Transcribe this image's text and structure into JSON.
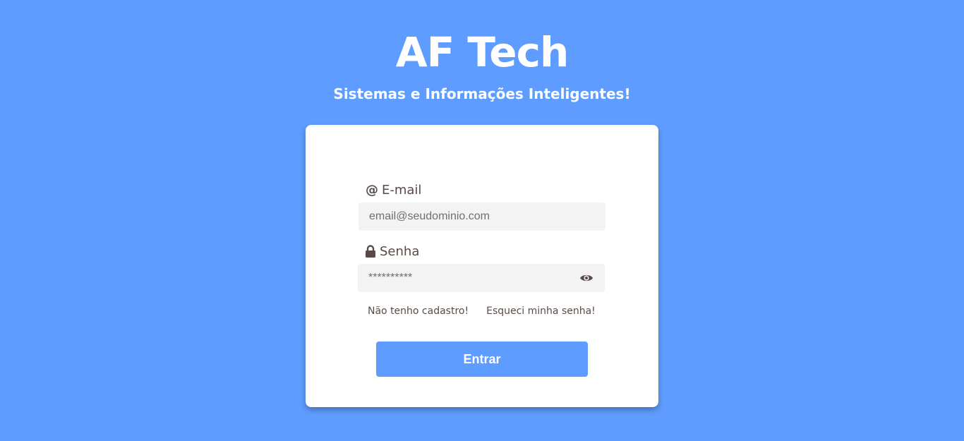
{
  "header": {
    "title": "AF Tech",
    "subtitle": "Sistemas e Informações Inteligentes!"
  },
  "form": {
    "email": {
      "icon": "at-icon",
      "label": "E-mail",
      "placeholder": "email@seudominio.com",
      "value": ""
    },
    "password": {
      "icon": "lock-icon",
      "label": "Senha",
      "placeholder": "**********",
      "value": "",
      "toggle_icon": "eye-icon"
    },
    "links": {
      "register": "Não tenho cadastro!",
      "forgot": "Esqueci minha senha!"
    },
    "submit_label": "Entrar"
  },
  "colors": {
    "background": "#5e9cff",
    "card": "#ffffff",
    "input_bg": "#f3f3f3",
    "label_text": "#5a4a45",
    "button": "#5e9cff"
  }
}
